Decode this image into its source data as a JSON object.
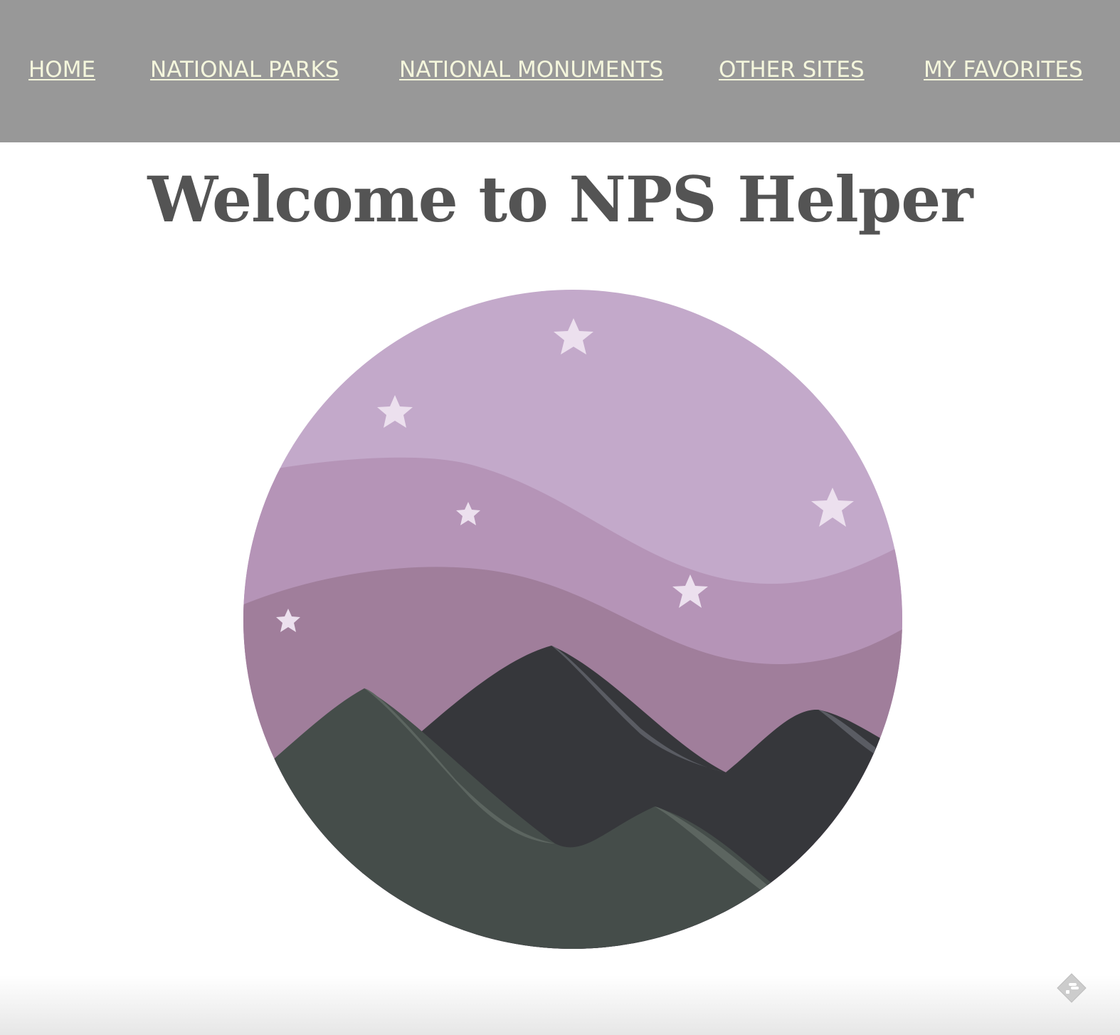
{
  "nav": {
    "items": [
      {
        "label": "HOME"
      },
      {
        "label": "NATIONAL PARKS"
      },
      {
        "label": "NATIONAL MONUMENTS"
      },
      {
        "label": "OTHER SITES"
      },
      {
        "label": "MY FAVORITES"
      }
    ]
  },
  "main": {
    "title": "Welcome to NPS Helper",
    "hero_icon": "night-mountains-illustration"
  },
  "floating": {
    "icon": "feedly-icon"
  },
  "colors": {
    "nav_bg": "#989898",
    "nav_text": "#f4f6dc",
    "title": "#545454",
    "sky_light": "#c3a9ca",
    "sky_mid": "#b594b7",
    "sky_dark": "#a07e9b",
    "mountain_dark": "#36373b",
    "mountain_green": "#454d4a",
    "star": "#ece0ee"
  }
}
